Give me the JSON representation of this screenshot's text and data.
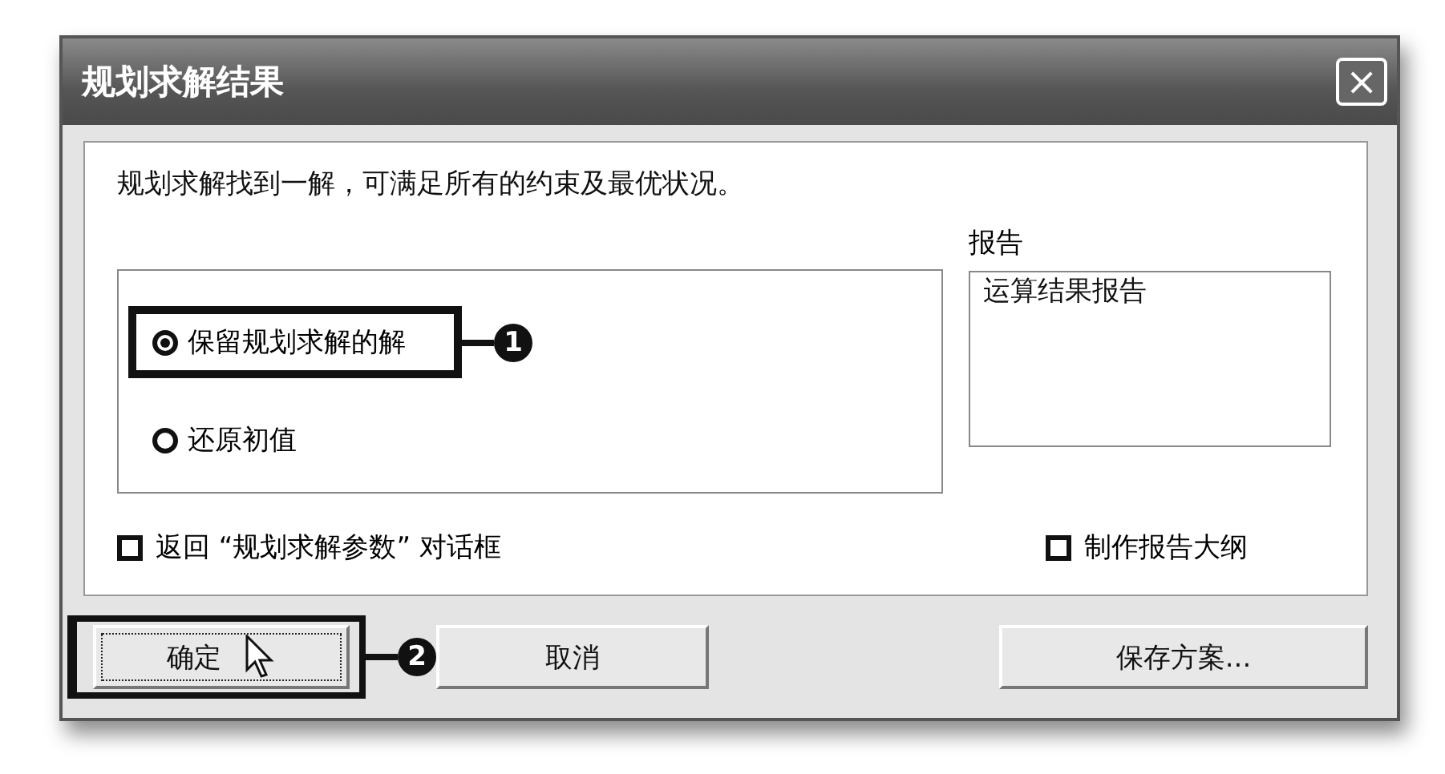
{
  "window": {
    "title": "规划求解结果",
    "close": "×"
  },
  "message": "规划求解找到一解，可满足所有的约束及最优状况。",
  "options": [
    {
      "label": "保留规划求解的解",
      "selected": true,
      "callout": "1"
    },
    {
      "label": "还原初值",
      "selected": false
    }
  ],
  "reports": {
    "label": "报告",
    "items": [
      {
        "label": "运算结果报告",
        "selected": false
      }
    ]
  },
  "checkboxes": [
    {
      "label": "返回 “规划求解参数” 对话框",
      "checked": false
    },
    {
      "label": "制作报告大纲",
      "checked": false
    }
  ],
  "buttons": [
    {
      "label": "确定",
      "focused": true,
      "callout": "2",
      "pointer": true
    },
    {
      "label": "取消",
      "focused": false
    },
    {
      "label": "保存方案...",
      "focused": false
    }
  ]
}
